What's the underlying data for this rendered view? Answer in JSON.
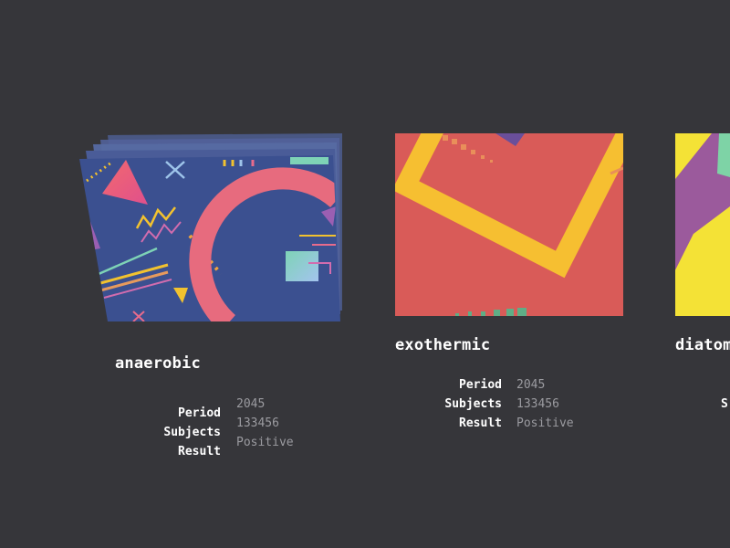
{
  "labels": {
    "period": "Period",
    "subjects": "Subjects",
    "result": "Result"
  },
  "cards": [
    {
      "title": "anaerobic",
      "period": "2045",
      "subjects": "133456",
      "result": "Positive",
      "background": "#3b5090"
    },
    {
      "title": "exothermic",
      "period": "2045",
      "subjects": "133456",
      "result": "Positive",
      "background": "#d95b58"
    },
    {
      "title": "diatom",
      "period": "",
      "subjects": "",
      "result": "",
      "background": "#f4e236"
    }
  ],
  "partial": {
    "title3_visible": "diatom",
    "subjects3_visible": "S"
  },
  "colors": {
    "page_bg": "#36363a",
    "title": "#ffffff",
    "label": "#ffffff",
    "value": "#9b9ba0"
  }
}
